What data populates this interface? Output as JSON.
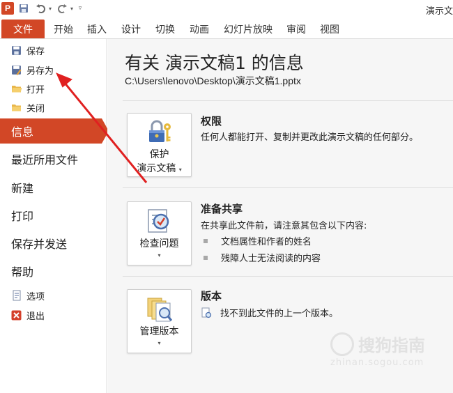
{
  "titlebar": {
    "app_logo": "P",
    "window_title": "演示文"
  },
  "ribbon": {
    "file_tab": "文件",
    "tabs": [
      "开始",
      "插入",
      "设计",
      "切换",
      "动画",
      "幻灯片放映",
      "审阅",
      "视图"
    ]
  },
  "nav": {
    "save": "保存",
    "save_as": "另存为",
    "open": "打开",
    "close": "关闭",
    "info": "信息",
    "recent": "最近所用文件",
    "new": "新建",
    "print": "打印",
    "save_send": "保存并发送",
    "help": "帮助",
    "options": "选项",
    "exit": "退出"
  },
  "main": {
    "title": "有关 演示文稿1 的信息",
    "path": "C:\\Users\\lenovo\\Desktop\\演示文稿1.pptx",
    "permissions": {
      "button_line1": "保护",
      "button_line2": "演示文稿",
      "heading": "权限",
      "description": "任何人都能打开、复制并更改此演示文稿的任何部分。"
    },
    "prepare": {
      "button_label": "检查问题",
      "heading": "准备共享",
      "description": "在共享此文件前，请注意其包含以下内容:",
      "bullets": [
        "文档属性和作者的姓名",
        "残障人士无法阅读的内容"
      ]
    },
    "versions": {
      "button_label": "管理版本",
      "heading": "版本",
      "description": "找不到此文件的上一个版本。"
    }
  },
  "watermark": {
    "brand": "搜狗指南",
    "url": "zhinan.sogou.com"
  },
  "colors": {
    "accent": "#d24726",
    "annotation": "#e02020"
  }
}
